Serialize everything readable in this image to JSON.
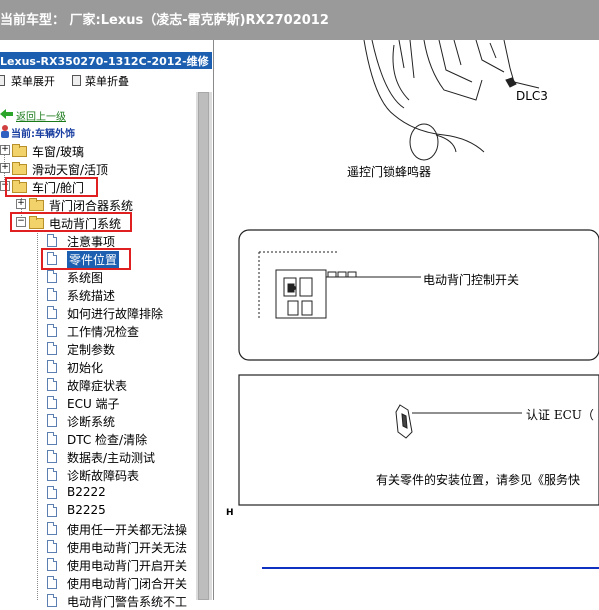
{
  "header": {
    "title": "当前车型：  厂家:Lexus（凌志-雷克萨斯)RX2702012"
  },
  "left_panel": {
    "title": "Lexus-RX350270-1312C-2012-维修",
    "toolbar": {
      "expand_label": "菜单展开",
      "collapse_label": "菜单折叠"
    },
    "back_link": "返回上一级",
    "current": "当前:车辆外饰",
    "tree": [
      {
        "label": "车窗/玻璃",
        "kind": "folder",
        "expander": "+"
      },
      {
        "label": "滑动天窗/活顶",
        "kind": "folder",
        "expander": "+"
      },
      {
        "label": "车门/舱门",
        "kind": "folder",
        "expander": "-",
        "highlighted": true
      },
      {
        "label": "背门闭合器系统",
        "kind": "folder",
        "expander": "+"
      },
      {
        "label": "电动背门系统",
        "kind": "folder",
        "expander": "-",
        "highlighted": true
      },
      {
        "label": "注意事项",
        "kind": "doc"
      },
      {
        "label": "零件位置",
        "kind": "doc",
        "highlighted": true,
        "selected": true
      },
      {
        "label": "系统图",
        "kind": "doc"
      },
      {
        "label": "系统描述",
        "kind": "doc"
      },
      {
        "label": "如何进行故障排除",
        "kind": "doc"
      },
      {
        "label": "工作情况检查",
        "kind": "doc"
      },
      {
        "label": "定制参数",
        "kind": "doc"
      },
      {
        "label": "初始化",
        "kind": "doc"
      },
      {
        "label": "故障症状表",
        "kind": "doc"
      },
      {
        "label": "ECU 端子",
        "kind": "doc"
      },
      {
        "label": "诊断系统",
        "kind": "doc"
      },
      {
        "label": "DTC 检查/清除",
        "kind": "doc"
      },
      {
        "label": "数据表/主动测试",
        "kind": "doc"
      },
      {
        "label": "诊断故障码表",
        "kind": "doc"
      },
      {
        "label": "B2222",
        "kind": "doc"
      },
      {
        "label": "B2225",
        "kind": "doc"
      },
      {
        "label": "使用任一开关都无法操",
        "kind": "doc"
      },
      {
        "label": "使用电动背门开关无法",
        "kind": "doc"
      },
      {
        "label": "使用电动背门开启开关",
        "kind": "doc"
      },
      {
        "label": "使用电动背门闭合开关",
        "kind": "doc"
      },
      {
        "label": "电动背门警告系统不工",
        "kind": "doc"
      }
    ]
  },
  "diagram": {
    "dlc_label": "DLC3",
    "buzzer_label": "遥控门锁蜂鸣器",
    "switch_label": "电动背门控制开关",
    "ecu_label": "认证 ECU（",
    "note_text": "有关零件的安装位置，请参见《服务快",
    "corner_letter": "H"
  }
}
